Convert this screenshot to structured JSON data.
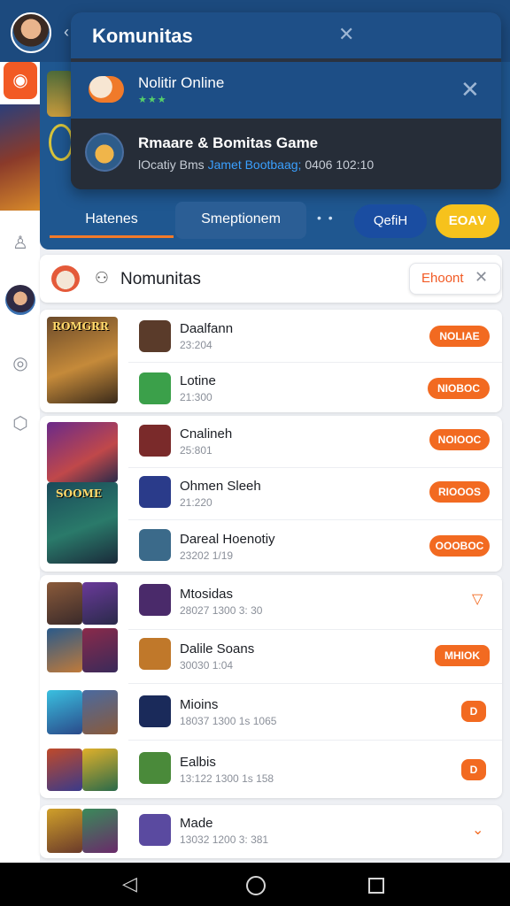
{
  "overlay": {
    "title": "Komunitas",
    "notification": {
      "title": "Nolitir Online",
      "stars": "★★★"
    },
    "game_row": {
      "title": "Rmaare & Bomitas Game",
      "sub_prefix": "lOcatiy Bms",
      "sub_link": "Jamet Bootbaag;",
      "sub_suffix": "0406  102:10"
    }
  },
  "tabs": {
    "items": [
      {
        "label": "Hatenes"
      },
      {
        "label": "Smeptionem"
      }
    ],
    "dots": "• •",
    "blue_pill": "QefiH",
    "yellow_pill": "ЕOАV"
  },
  "community": {
    "title": "Nomunitas",
    "button_label": "Ehoont"
  },
  "covers": {
    "g1": "ROMGRR",
    "g2": "SOOME"
  },
  "rows": [
    {
      "name": "Daalfann",
      "meta": "23:204",
      "badge": "NOLIAE",
      "icon_color": "#5a3b2a"
    },
    {
      "name": "Lotine",
      "meta": "21:300",
      "badge": "NIOBOC",
      "icon_color": "#3ba04a"
    },
    {
      "name": "Cnalineh",
      "meta": "25:801",
      "badge": "NOIOOC",
      "icon_color": "#7a2a2a"
    },
    {
      "name": "Ohmen Sleeh",
      "meta": "21:220",
      "badge": "RIOOOS",
      "icon_color": "#2a3b8a"
    },
    {
      "name": "Dareal Hoenotiy",
      "meta": "23202 1/19",
      "badge": "OOOBOC",
      "icon_color": "#3b6a8a"
    },
    {
      "name": "Mtosidas",
      "meta": "28027 1300 3: 30",
      "badge": "",
      "icon_color": "#4a2a6a"
    },
    {
      "name": "Dalile Soans",
      "meta": "30030 1:04",
      "badge": "MHIOK",
      "icon_color": "#c0782a"
    },
    {
      "name": "Mioins",
      "meta": "18037 1300 1s 1065",
      "badge": "D",
      "icon_color": "#1a2a5a"
    },
    {
      "name": "Ealbis",
      "meta": "13:122 1300 1s 158",
      "badge": "D",
      "icon_color": "#4a8a3a"
    },
    {
      "name": "Made",
      "meta": "13032 1200 3: 381",
      "badge": "",
      "icon_color": "#5a4aa0"
    }
  ],
  "colors": {
    "accent": "#f26a21",
    "header_blue": "#1c4a7e",
    "panel_dark": "#2a3240",
    "yellow": "#f6c21c"
  },
  "icons": [
    "avatar",
    "back-icon",
    "status-dot-icon",
    "more-vert-icon",
    "close-icon",
    "person-icon",
    "chevron-down-icon",
    "home-icon",
    "nav-back-icon",
    "nav-home-icon",
    "nav-recent-icon"
  ]
}
